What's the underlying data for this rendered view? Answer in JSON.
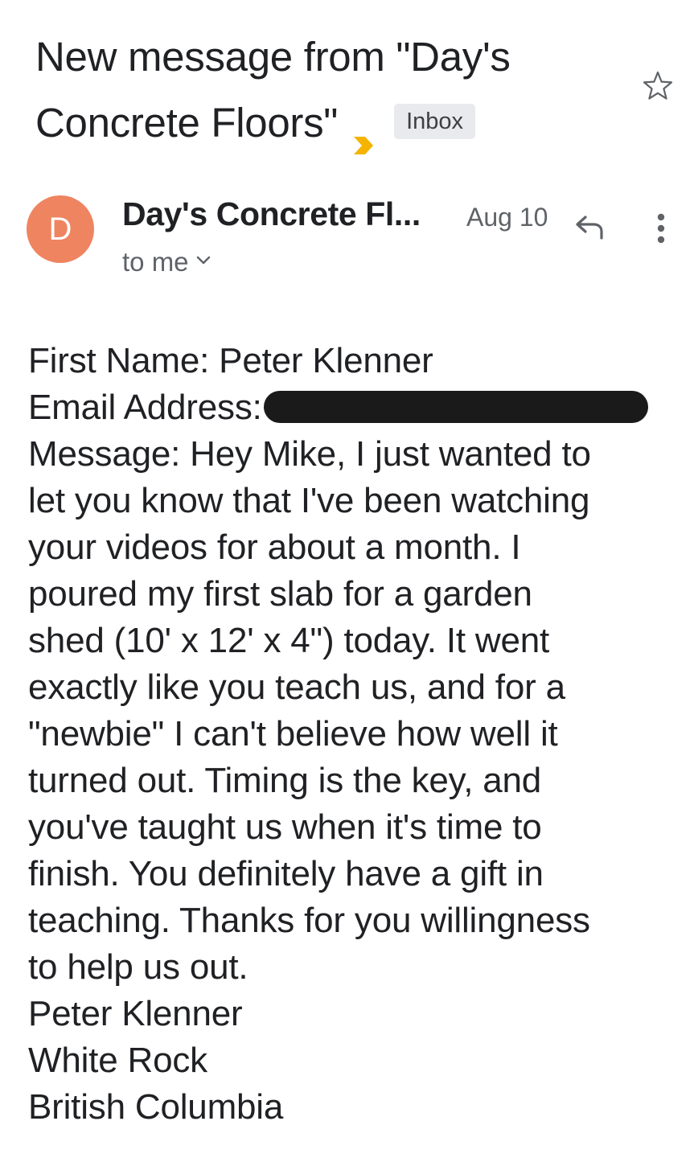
{
  "subject": {
    "text": "New message from \"Day's Concrete Floors\"",
    "label": "Inbox",
    "importance_icon": "importance-marker-icon",
    "star_icon": "star-outline-icon"
  },
  "message": {
    "avatar_letter": "D",
    "avatar_color": "#ef8460",
    "sender": "Day's Concrete Fl...",
    "date": "Aug 10",
    "recipients": "to me",
    "reply_icon": "reply-icon",
    "more_icon": "more-vert-icon"
  },
  "body": {
    "first_name_line": "First Name: Peter Klenner",
    "email_label": "Email Address:",
    "message_lines": [
      "Message: Hey Mike, I just wanted to",
      "let you know that I've been watching",
      "your videos for about a month. I",
      "poured my first slab for a garden",
      "shed (10' x 12' x 4\") today. It went",
      "exactly like you teach us, and for a",
      "\"newbie\" I can't believe how well it",
      "turned out. Timing is the key, and",
      "you've taught us when it's time to",
      "finish. You definitely have a gift in",
      "teaching. Thanks for you willingness",
      "to help us out."
    ],
    "signature_lines": [
      "Peter Klenner",
      "White Rock",
      "British Columbia"
    ]
  },
  "colors": {
    "importance": "#f4b400",
    "label_bg": "#e8eaed",
    "secondary_text": "#5f6368",
    "primary_text": "#202124"
  }
}
